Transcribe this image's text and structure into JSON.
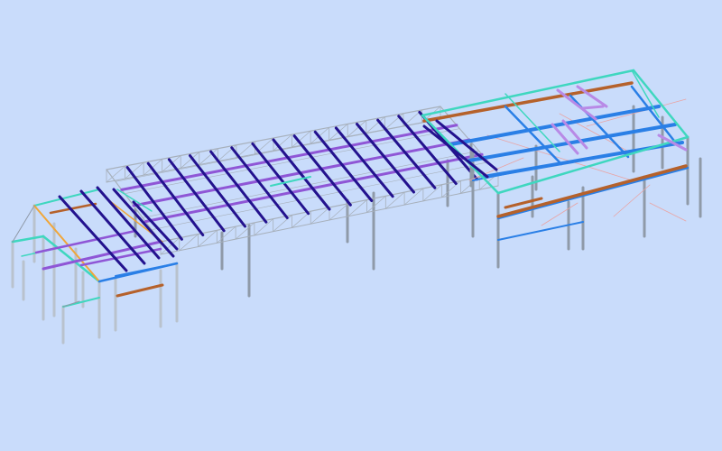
{
  "viewport": {
    "background": "#c9dcfb",
    "model_type": "3d-steel-frame-wireframe"
  },
  "colors": {
    "column": "#8f9aa8",
    "column_light": "#b9c2cd",
    "truss": "#a7b0bb",
    "rafter": "#23128e",
    "purlin": "#8f56d6",
    "edge_beam": "#3fd7bf",
    "blue_beam": "#2a7fe6",
    "rust_beam": "#b5612b",
    "orange_beam": "#f0a63a",
    "bracing": "#e9a4a4",
    "lavender": "#b88ae6"
  }
}
